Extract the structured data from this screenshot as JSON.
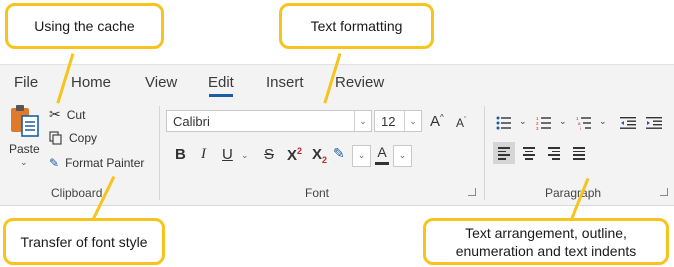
{
  "callouts": {
    "cache": "Using the cache",
    "text_formatting": "Text formatting",
    "font_style": "Transfer of font style",
    "arrangement": "Text arrangement, outline, enumeration and text indents"
  },
  "tabs": [
    "File",
    "Home",
    "View",
    "Edit",
    "Insert",
    "Review"
  ],
  "active_tab": "Edit",
  "clipboard": {
    "paste_label": "Paste",
    "cut_label": "Cut",
    "copy_label": "Copy",
    "format_painter_label": "Format Painter",
    "group_label": "Clipboard"
  },
  "font": {
    "font_name": "Calibri",
    "font_size": "12",
    "grow_label": "A",
    "shrink_label": "A",
    "bold": "B",
    "italic": "I",
    "underline": "U",
    "strike": "S",
    "superscript": "X",
    "superscript_mark": "2",
    "subscript": "X",
    "subscript_mark": "2",
    "color_letter": "A",
    "group_label": "Font"
  },
  "paragraph": {
    "group_label": "Paragraph"
  },
  "colors": {
    "callout_border": "#f7c31d",
    "accent": "#1b5ea8",
    "superscript_red": "#c0272d"
  }
}
